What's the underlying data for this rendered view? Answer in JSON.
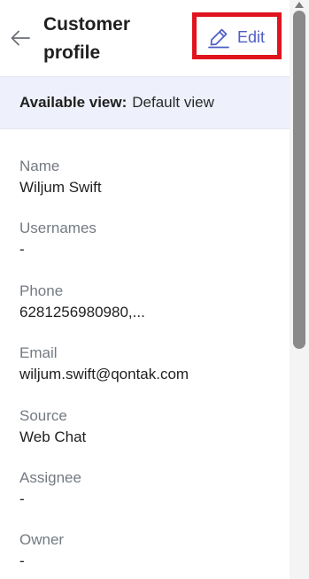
{
  "header": {
    "title": "Customer profile",
    "edit_label": "Edit",
    "back_icon": "arrow-left-icon",
    "edit_icon": "pencil-icon"
  },
  "view": {
    "label": "Available view:",
    "value": "Default view"
  },
  "fields": [
    {
      "label": "Name",
      "value": "Wiljum Swift"
    },
    {
      "label": "Usernames",
      "value": "-"
    },
    {
      "label": "Phone",
      "value": "6281256980980,..."
    },
    {
      "label": "Email",
      "value": "wiljum.swift@qontak.com"
    },
    {
      "label": "Source",
      "value": "Web Chat"
    },
    {
      "label": "Assignee",
      "value": "-"
    },
    {
      "label": "Owner",
      "value": "-"
    }
  ],
  "colors": {
    "accent": "#4e5ec4",
    "highlight_box": "#e0141f",
    "view_bar_bg": "#eef0fb",
    "label_gray": "#747a82"
  }
}
